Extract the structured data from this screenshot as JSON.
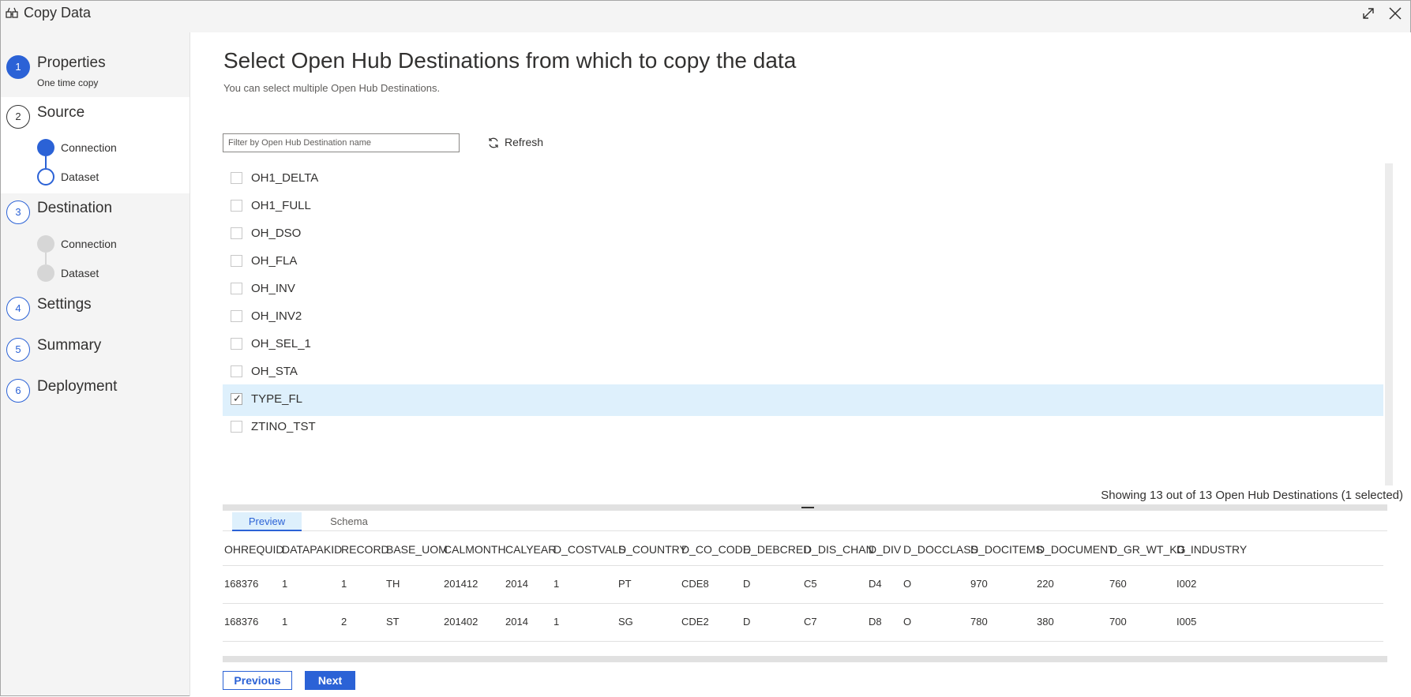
{
  "window": {
    "title": "Copy Data"
  },
  "icons": {
    "app": "copy-data-icon",
    "expand": "expand-icon",
    "close": "close-icon",
    "refresh": "refresh-icon",
    "check": "checkmark-icon"
  },
  "colors": {
    "accent": "#2b62d6",
    "selected_row": "#def0fc",
    "inactive_step": "#d6d6d6"
  },
  "steps": [
    {
      "number": "1",
      "title": "Properties",
      "subtitle": "One time copy",
      "state": "done"
    },
    {
      "number": "2",
      "title": "Source",
      "state": "current",
      "substeps": [
        {
          "label": "Connection",
          "state": "done"
        },
        {
          "label": "Dataset",
          "state": "current"
        }
      ]
    },
    {
      "number": "3",
      "title": "Destination",
      "state": "pending",
      "substeps": [
        {
          "label": "Connection",
          "state": "pending"
        },
        {
          "label": "Dataset",
          "state": "pending"
        }
      ]
    },
    {
      "number": "4",
      "title": "Settings",
      "state": "pending"
    },
    {
      "number": "5",
      "title": "Summary",
      "state": "pending"
    },
    {
      "number": "6",
      "title": "Deployment",
      "state": "pending"
    }
  ],
  "main": {
    "title": "Select Open Hub Destinations from which to copy the data",
    "subtitle": "You can select multiple Open Hub Destinations.",
    "filter_placeholder": "Filter by Open Hub Destination name",
    "refresh_label": "Refresh",
    "items": [
      {
        "label": "OH1_DELTA",
        "checked": false
      },
      {
        "label": "OH1_FULL",
        "checked": false
      },
      {
        "label": "OH_DSO",
        "checked": false
      },
      {
        "label": "OH_FLA",
        "checked": false
      },
      {
        "label": "OH_INV",
        "checked": false
      },
      {
        "label": "OH_INV2",
        "checked": false
      },
      {
        "label": "OH_SEL_1",
        "checked": false
      },
      {
        "label": "OH_STA",
        "checked": false
      },
      {
        "label": "TYPE_FL",
        "checked": true
      },
      {
        "label": "ZTINO_TST",
        "checked": false
      }
    ],
    "count_text": "Showing 13 out of 13 Open Hub Destinations (1 selected)",
    "tabs": {
      "preview": "Preview",
      "schema": "Schema"
    }
  },
  "table": {
    "columns": [
      "OHREQUID",
      "DATAPAKID",
      "RECORD",
      "BASE_UOM",
      "CALMONTH",
      "CALYEAR",
      "D_COSTVALS",
      "D_COUNTRY",
      "D_CO_CODE",
      "D_DEBCRED",
      "D_DIS_CHAN",
      "D_DIV",
      "D_DOCCLASS",
      "D_DOCITEMS",
      "D_DOCUMENT",
      "D_GR_WT_KG",
      "D_INDUSTRY"
    ],
    "rows": [
      [
        "168376",
        "1",
        "1",
        "TH",
        "201412",
        "2014",
        "1",
        "PT",
        "CDE8",
        "D",
        "C5",
        "D4",
        "O",
        "970",
        "220",
        "760",
        "I002"
      ],
      [
        "168376",
        "1",
        "2",
        "ST",
        "201402",
        "2014",
        "1",
        "SG",
        "CDE2",
        "D",
        "C7",
        "D8",
        "O",
        "780",
        "380",
        "700",
        "I005"
      ]
    ]
  },
  "buttons": {
    "previous": "Previous",
    "next": "Next"
  }
}
